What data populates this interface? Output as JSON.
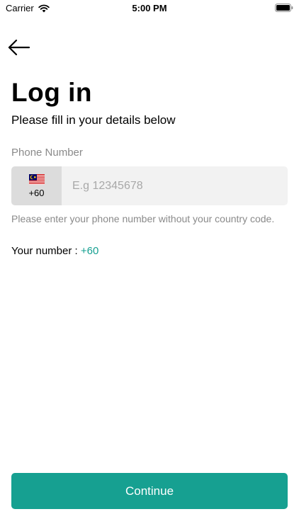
{
  "status_bar": {
    "carrier": "Carrier",
    "time": "5:00 PM"
  },
  "header": {
    "back_icon": "arrow-left-icon"
  },
  "main": {
    "title": "Log in",
    "subtitle": "Please fill in your details below",
    "phone_label": "Phone Number",
    "country_flag_icon": "malaysia-flag-icon",
    "country_code": "+60",
    "phone_value": "",
    "phone_placeholder": "E.g 12345678",
    "helper_text": "Please enter your phone number without your country code.",
    "your_number_label": "Your number : ",
    "your_number_value": "+60"
  },
  "footer": {
    "continue_label": "Continue"
  },
  "colors": {
    "accent": "#16a091",
    "input_bg": "#f2f2f2",
    "country_bg": "#dcdcdc",
    "muted_text": "#8a8a8a"
  }
}
